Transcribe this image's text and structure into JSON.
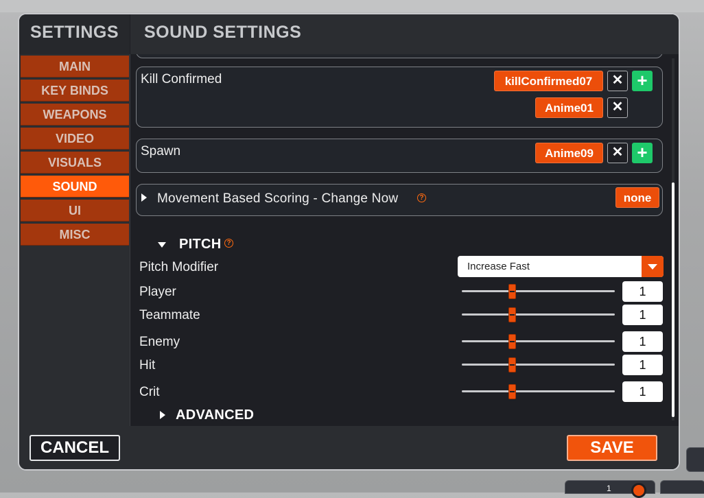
{
  "header": {
    "left_title": "SETTINGS",
    "right_title": "SOUND SETTINGS"
  },
  "sidebar": {
    "items": [
      {
        "label": "MAIN",
        "active": false
      },
      {
        "label": "KEY BINDS",
        "active": false
      },
      {
        "label": "WEAPONS",
        "active": false
      },
      {
        "label": "VIDEO",
        "active": false
      },
      {
        "label": "VISUALS",
        "active": false
      },
      {
        "label": "SOUND",
        "active": true
      },
      {
        "label": "UI",
        "active": false
      },
      {
        "label": "MISC",
        "active": false
      }
    ]
  },
  "sounds": {
    "kill_confirmed": {
      "label": "Kill Confirmed",
      "tags": [
        "killConfirmed07",
        "Anime01"
      ]
    },
    "spawn": {
      "label": "Spawn",
      "tags": [
        "Anime09"
      ]
    },
    "movement_scoring": {
      "label": "Movement Based Scoring - Change Now",
      "value": "none"
    }
  },
  "pitch": {
    "title": "PITCH",
    "modifier_label": "Pitch Modifier",
    "modifier_value": "Increase Fast",
    "rows": [
      {
        "label": "Player",
        "value": "1",
        "level": 0.33
      },
      {
        "label": "Teammate",
        "value": "1",
        "level": 0.33
      },
      {
        "label": "Enemy",
        "value": "1",
        "level": 0.33
      },
      {
        "label": "Hit",
        "value": "1",
        "level": 0.33
      },
      {
        "label": "Crit",
        "value": "1",
        "level": 0.33
      }
    ]
  },
  "advanced": {
    "title": "ADVANCED"
  },
  "footer": {
    "cancel_label": "CANCEL",
    "save_label": "SAVE"
  },
  "hud": {
    "slot_value": "1"
  },
  "colors": {
    "accent": "#ec4e0a",
    "active_tab": "#ff5a0a",
    "tab": "#a4370d",
    "add": "#1ec96a",
    "panel": "#1e1f24"
  },
  "icons": {
    "remove": "close-icon",
    "add": "plus-icon",
    "expand": "triangle-right-icon",
    "collapse": "triangle-down-icon",
    "help": "help-icon",
    "dropdown": "chevron-down-icon"
  }
}
